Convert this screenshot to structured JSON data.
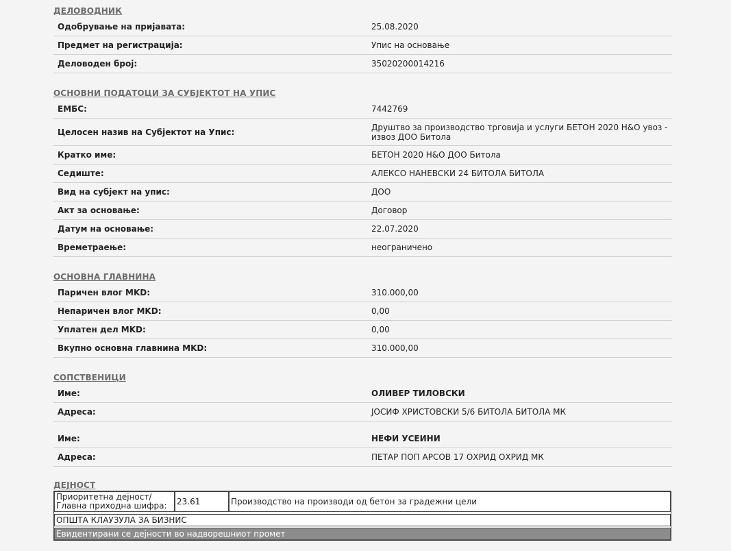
{
  "registry": {
    "title": "ДЕЛОВОДНИК",
    "rows": [
      {
        "label": "Одобрување на пријавата:",
        "value": "25.08.2020"
      },
      {
        "label": "Предмет на регистрација:",
        "value": "Упис на основање"
      },
      {
        "label": "Деловоден број:",
        "value": "35020200014216"
      }
    ]
  },
  "basic": {
    "title": "ОСНОВНИ ПОДАТОЦИ ЗА СУБЈЕКТОТ НА УПИС",
    "rows": [
      {
        "label": "ЕМБС:",
        "value": "7442769"
      },
      {
        "label": "Целосен назив на Субјектот на Упис:",
        "value": "Друштво за производство трговија и услуги БЕТОН 2020 Н&О увоз - извоз ДОО Битола"
      },
      {
        "label": "Кратко име:",
        "value": "БЕТОН 2020 Н&О ДОО Битола"
      },
      {
        "label": "Седиште:",
        "value": "АЛЕКСО НАНЕВСКИ 24 БИТОЛА БИТОЛА"
      },
      {
        "label": "Вид на субјект на упис:",
        "value": "ДОО"
      },
      {
        "label": "Акт за основање:",
        "value": "Договор"
      },
      {
        "label": "Датум на основање:",
        "value": "22.07.2020"
      },
      {
        "label": "Времетраење:",
        "value": "неограничено"
      }
    ]
  },
  "capital": {
    "title": "ОСНОВНА ГЛАВНИНА",
    "rows": [
      {
        "label": "Паричен влог MKD:",
        "value": "310.000,00"
      },
      {
        "label": "Непаричен влог MKD:",
        "value": "0,00"
      },
      {
        "label": "Уплатен дел MKD:",
        "value": "0,00"
      },
      {
        "label": "Вкупно основна главнина MKD:",
        "value": "310.000,00"
      }
    ]
  },
  "owners": {
    "title": "СОПСТВЕНИЦИ",
    "list": [
      {
        "name_label": "Име:",
        "name": "ОЛИВЕР ТИЛОВСКИ",
        "address_label": "Адреса:",
        "address": "ЈОСИФ ХРИСТОВСКИ 5/6 БИТОЛА БИТОЛА МК"
      },
      {
        "name_label": "Име:",
        "name": "НЕФИ УСЕИНИ",
        "address_label": "Адреса:",
        "address": "ПЕТАР ПОП АРСОВ 17 ОХРИД ОХРИД МК"
      }
    ]
  },
  "activity": {
    "title": "ДЕЈНОСТ",
    "priority_label_1": "Приоритетна дејност/",
    "priority_label_2": "Главна приходна шифра:",
    "code": "23.61",
    "description": "Производство на производи од бетон за градежни цели",
    "clause": "ОПШТА КЛАУЗУЛА ЗА БИЗНИС",
    "registered": "Евидентирани се дејности во надворешниот промет"
  },
  "colors": {
    "section_title": "#6b6b6b",
    "row_border": "#cfcfcf",
    "gray_bar": "#8c8c8c",
    "background": "#f4f4f4"
  }
}
